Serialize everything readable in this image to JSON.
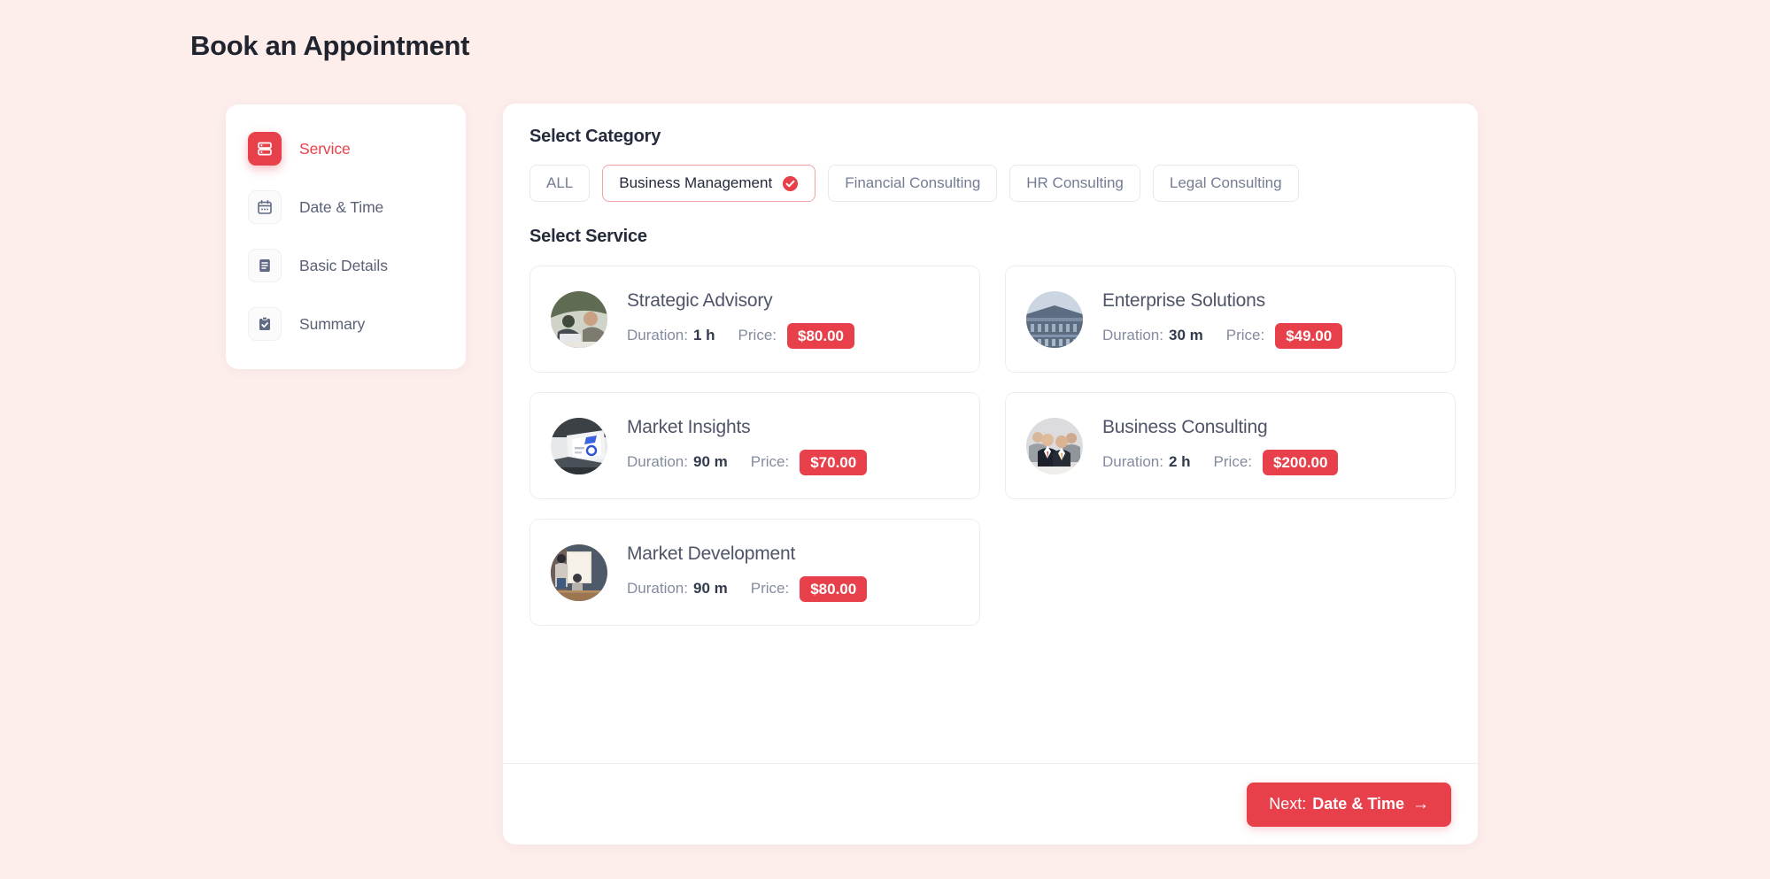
{
  "page": {
    "title": "Book an Appointment"
  },
  "colors": {
    "background": "#fdeeec",
    "accent": "#e8404a",
    "panel": "#ffffff",
    "muted_text": "#737c92",
    "heading_text": "#252b3b"
  },
  "sidebar": {
    "steps": [
      {
        "label": "Service",
        "icon": "server-list-icon",
        "active": true
      },
      {
        "label": "Date & Time",
        "icon": "calendar-icon",
        "active": false
      },
      {
        "label": "Basic Details",
        "icon": "document-lines-icon",
        "active": false
      },
      {
        "label": "Summary",
        "icon": "clipboard-check-icon",
        "active": false
      }
    ]
  },
  "main": {
    "category_heading": "Select Category",
    "categories": [
      {
        "label": "ALL",
        "selected": false
      },
      {
        "label": "Business Management",
        "selected": true
      },
      {
        "label": "Financial Consulting",
        "selected": false
      },
      {
        "label": "HR Consulting",
        "selected": false
      },
      {
        "label": "Legal Consulting",
        "selected": false
      }
    ],
    "service_heading": "Select Service",
    "duration_label": "Duration:",
    "price_label": "Price:",
    "services": [
      {
        "name": "Strategic Advisory",
        "duration": "1 h",
        "price": "$80.00",
        "image": "people-at-laptop-photo"
      },
      {
        "name": "Enterprise Solutions",
        "duration": "30 m",
        "price": "$49.00",
        "image": "office-building-photo"
      },
      {
        "name": "Market Insights",
        "duration": "90 m",
        "price": "$70.00",
        "image": "laptop-screen-photo"
      },
      {
        "name": "Business Consulting",
        "duration": "2 h",
        "price": "$200.00",
        "image": "business-meeting-photo"
      },
      {
        "name": "Market Development",
        "duration": "90 m",
        "price": "$80.00",
        "image": "whiteboard-presentation-photo"
      }
    ],
    "footer": {
      "next_prefix": "Next:",
      "next_target": "Date & Time",
      "arrow": "→"
    }
  }
}
